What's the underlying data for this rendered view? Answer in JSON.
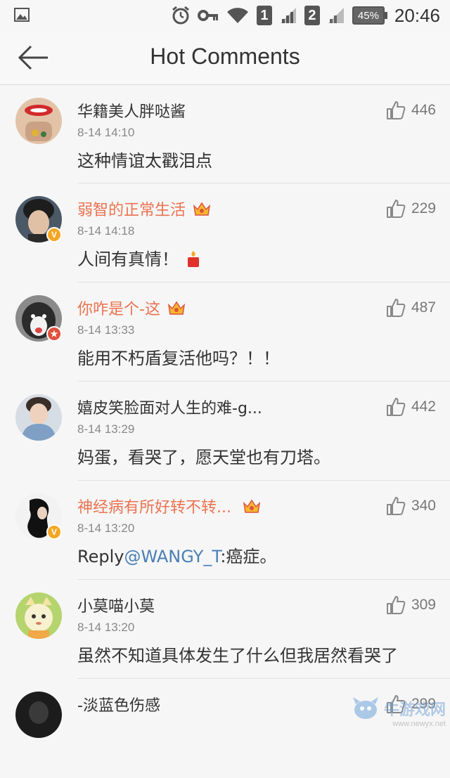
{
  "status_bar": {
    "sim1": "1",
    "sim2": "2",
    "battery": "45%",
    "time": "20:46"
  },
  "header": {
    "title": "Hot Comments"
  },
  "comments": [
    {
      "name": "华籍美人胖哒酱",
      "time": "8-14 14:10",
      "text": "这种情谊太戳泪点",
      "likes": "446",
      "vip": false,
      "badge": "",
      "crown": false,
      "avatar_color": "#d8b69c"
    },
    {
      "name": "弱智的正常生活",
      "time": "8-14 14:18",
      "text": "人间有真情！",
      "likes": "229",
      "vip": true,
      "badge": "V",
      "crown": true,
      "avatar_color": "#3d4a5a"
    },
    {
      "name": "你咋是个-这",
      "time": "8-14 13:33",
      "text": "能用不朽盾复活他吗？！！",
      "likes": "487",
      "vip": true,
      "badge": "★",
      "crown": true,
      "avatar_color": "#6b6b6b"
    },
    {
      "name": "嬉皮笑脸面对人生的难-g...",
      "time": "8-14 13:29",
      "text": "妈蛋，看哭了，愿天堂也有刀塔。",
      "likes": "442",
      "vip": false,
      "badge": "",
      "crown": false,
      "avatar_color": "#c5cdd8"
    },
    {
      "name": "神经病有所好转不转...",
      "time": "8-14 13:20",
      "text_prefix": "Reply",
      "mention": "@WANGY_T",
      "text_suffix": ":癌症。",
      "likes": "340",
      "vip": true,
      "badge": "V",
      "crown": true,
      "avatar_color": "#222222"
    },
    {
      "name": "小莫喵小莫",
      "time": "8-14 13:20",
      "text": "虽然不知道具体发生了什么但我居然看哭了",
      "likes": "309",
      "vip": false,
      "badge": "",
      "crown": false,
      "avatar_color": "#f3e7a8"
    },
    {
      "name": "-淡蓝色伤感",
      "likes": "299",
      "vip": false,
      "badge": "",
      "crown": false,
      "avatar_color": "#1c1c1c"
    }
  ],
  "watermark": {
    "text": "牛游戏网",
    "url": "www.newyx.net"
  },
  "icons": {
    "back": "back-arrow-icon",
    "like": "thumbs-up-icon",
    "crown": "vip-crown-icon"
  }
}
